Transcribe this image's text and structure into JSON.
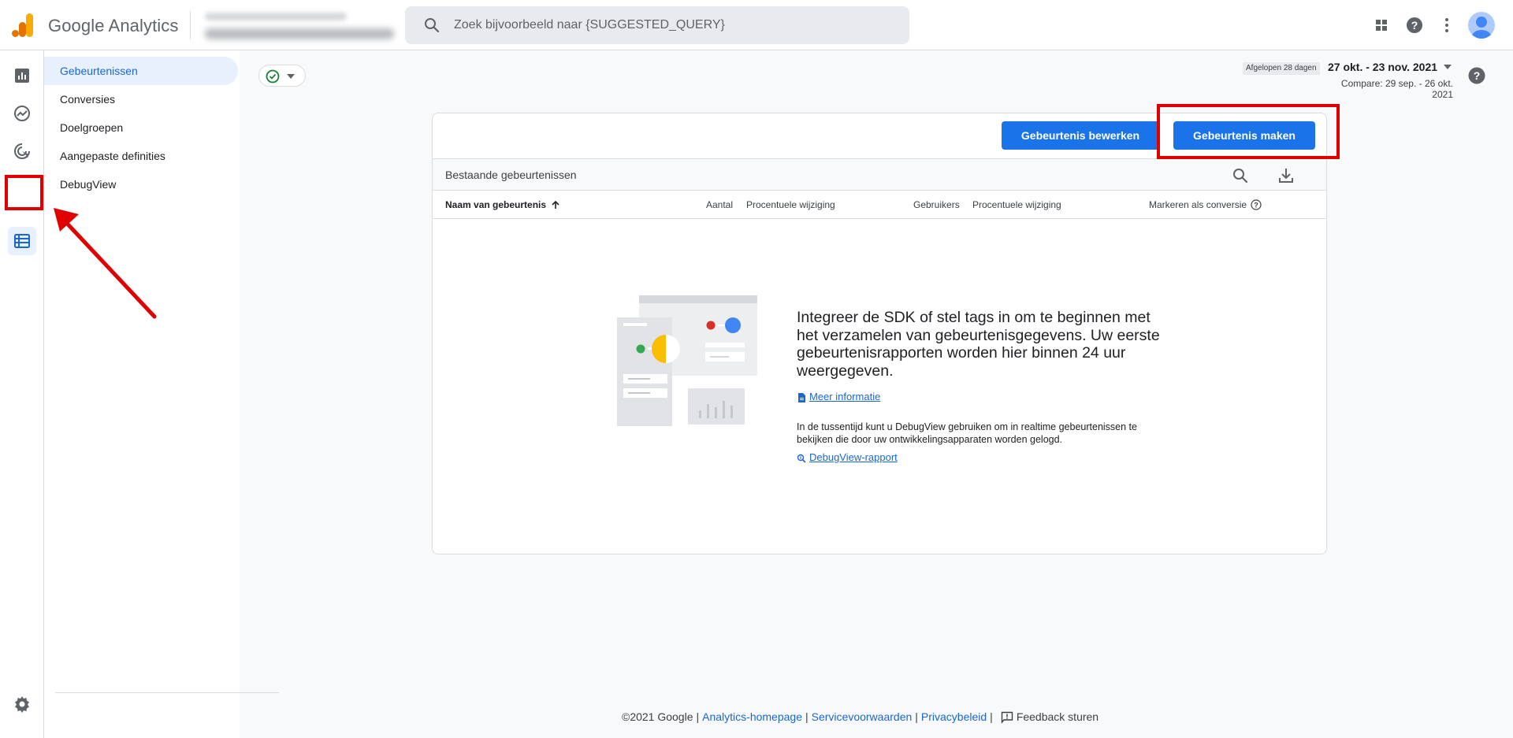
{
  "header": {
    "app_title": "Google Analytics",
    "search_placeholder": "Zoek bijvoorbeeld naar {SUGGESTED_QUERY}",
    "icons": [
      "apps-grid-icon",
      "help-icon",
      "more-vert-icon",
      "account-avatar"
    ]
  },
  "rail": {
    "items": [
      "reports-icon",
      "explore-icon",
      "advertising-icon",
      "configure-icon"
    ],
    "active": "configure-icon",
    "bottom": "settings-icon"
  },
  "subnav": {
    "items": [
      {
        "label": "Gebeurtenissen",
        "active": true
      },
      {
        "label": "Conversies",
        "active": false
      },
      {
        "label": "Doelgroepen",
        "active": false
      },
      {
        "label": "Aangepaste definities",
        "active": false
      },
      {
        "label": "DebugView",
        "active": false
      }
    ]
  },
  "date": {
    "badge": "Afgelopen 28 dagen",
    "range": "27 okt. - 23 nov. 2021",
    "compare": "Compare: 29 sep. - 26 okt. 2021"
  },
  "card": {
    "edit_button": "Gebeurtenis bewerken",
    "create_button": "Gebeurtenis maken",
    "bar_title": "Bestaande gebeurtenissen",
    "columns": {
      "name": "Naam van gebeurtenis",
      "count": "Aantal",
      "count_change": "Procentuele wijziging",
      "users": "Gebruikers",
      "users_change": "Procentuele wijziging",
      "conversion": "Markeren als conversie"
    },
    "empty": {
      "title": "Integreer de SDK of stel tags in om te beginnen met het verzamelen van gebeurtenisgegevens. Uw eerste gebeurtenisrapporten worden hier binnen 24 uur weergegeven.",
      "learn_more": "Meer informatie",
      "description": "In de tussentijd kunt u DebugView gebruiken om in realtime gebeurtenissen te bekijken die door uw ontwikkelingsapparaten worden gelogd.",
      "debugview_link": "DebugView-rapport"
    }
  },
  "footer": {
    "copyright": "©2021 Google",
    "links": [
      "Analytics-homepage",
      "Servicevoorwaarden",
      "Privacybeleid"
    ],
    "feedback": "Feedback sturen"
  },
  "colors": {
    "primary": "#1a73e8",
    "active_nav_bg": "#e8f0fe",
    "active_nav_text": "#1967d2",
    "annotation_red": "#e00000",
    "logo_orange": "#f9ab00",
    "logo_dark_orange": "#e37400"
  }
}
